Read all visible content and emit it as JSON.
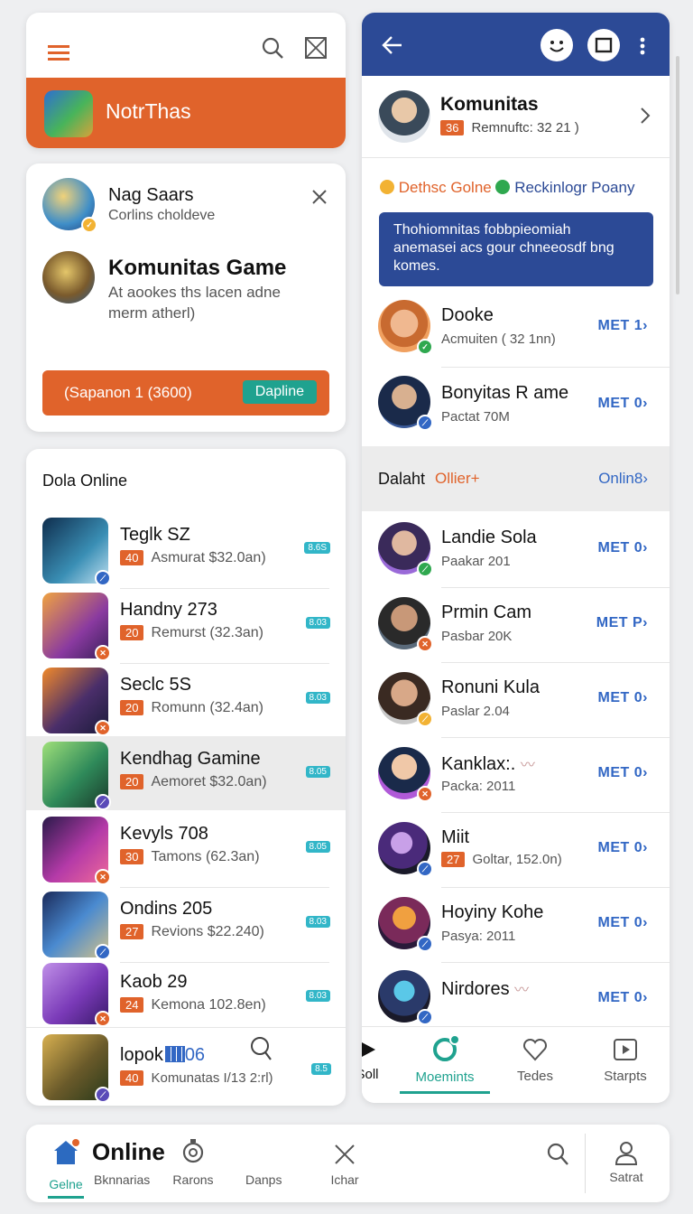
{
  "top_left": {
    "app_title": "NotrThas"
  },
  "suggest_card": {
    "name": "Nag Saars",
    "subtitle": "Corlins choldeve",
    "game_title": "Komunitas Game",
    "game_desc_1": "At aookes ths lacen adne",
    "game_desc_2": "merm atherl)",
    "bar_text": "(Sapanon 1 (3600)",
    "bar_button": "Dapline"
  },
  "left_list": {
    "header": "Dola Online",
    "items": [
      {
        "title": "Teglk SZ",
        "badge": "40",
        "sub": "Asmurat $32.0an)",
        "tag": "8.6S"
      },
      {
        "title": "Handny 273",
        "badge": "20",
        "sub": "Remurst (32.3an)",
        "tag": "8.03"
      },
      {
        "title": "Seclc 5S",
        "badge": "20",
        "sub": "Romunn (32.4an)",
        "tag": "8.03"
      },
      {
        "title": "Kendhag Gamine",
        "badge": "20",
        "sub": "Aemoret $32.0an)",
        "tag": "8.05"
      },
      {
        "title": "Kevyls 708",
        "badge": "30",
        "sub": "Tamons (62.3an)",
        "tag": "8.05"
      },
      {
        "title": "Ondins 205",
        "badge": "27",
        "sub": "Revions $22.240)",
        "tag": "8.03"
      },
      {
        "title": "Kaob 29",
        "badge": "24",
        "sub": "Kemona 102.8en)",
        "tag": "8.03"
      },
      {
        "title": "lopok",
        "title_suffix": "06",
        "badge": "40",
        "sub": "Komunatas I/13 2:rl)",
        "tag": "8.5"
      }
    ]
  },
  "right_panel": {
    "header_title": "Komunitas",
    "header_badge": "36",
    "header_sub": "Remnuftc: 32 21 )",
    "filter_left": "Dethsc Golne",
    "filter_right": "Reckinlogr Poany",
    "banner_line1": "Thohiomnitas fobbpieomiah",
    "banner_line2": "anemasei acs gour chneeosdf bng",
    "banner_line3": "komes.",
    "people_top": [
      {
        "name": "Dooke",
        "sub": "Acmuiten ( 32 1nn)",
        "action": "MET 1"
      },
      {
        "name": "Bonyitas R ame",
        "sub": "Pactat 70M",
        "action": "MET 0"
      }
    ],
    "section_left": "Dalaht",
    "section_mid": "Ollier+",
    "section_right": "Onlin8",
    "people": [
      {
        "name": "Landie Sola",
        "sub": "Paakar 201",
        "action": "MET 0"
      },
      {
        "name": "Prmin Cam",
        "sub": "Pasbar 20K",
        "action": "MET P"
      },
      {
        "name": "Ronuni Kula",
        "sub": "Paslar 2.04",
        "action": "MET 0"
      },
      {
        "name": "Kanklax:.",
        "sub": "Packa: 2011",
        "action": "MET 0"
      },
      {
        "name": "Miit",
        "badge": "27",
        "sub": "Goltar, 152.0n)",
        "action": "MET 0"
      },
      {
        "name": "Hoyiny Kohe",
        "sub": "Pasya: 2011",
        "action": "MET 0"
      },
      {
        "name": "Nirdores",
        "sub": "",
        "action": "MET 0"
      }
    ],
    "tabs": [
      {
        "label": "Soll",
        "icon": "play-icon"
      },
      {
        "label": "Moemints",
        "icon": "moments-icon"
      },
      {
        "label": "Tedes",
        "icon": "heart-icon"
      },
      {
        "label": "Starpts",
        "icon": "video-icon"
      }
    ]
  },
  "bottom_nav": {
    "brand": "Online",
    "items": [
      "Gelne",
      "Bknnarias",
      "Rarons",
      "Danps",
      "Ichar",
      "Satrat"
    ]
  },
  "colors": {
    "accent": "#e0632b",
    "navy": "#2c4a96",
    "teal": "#1fa28f",
    "blue_text": "#3267c4"
  }
}
